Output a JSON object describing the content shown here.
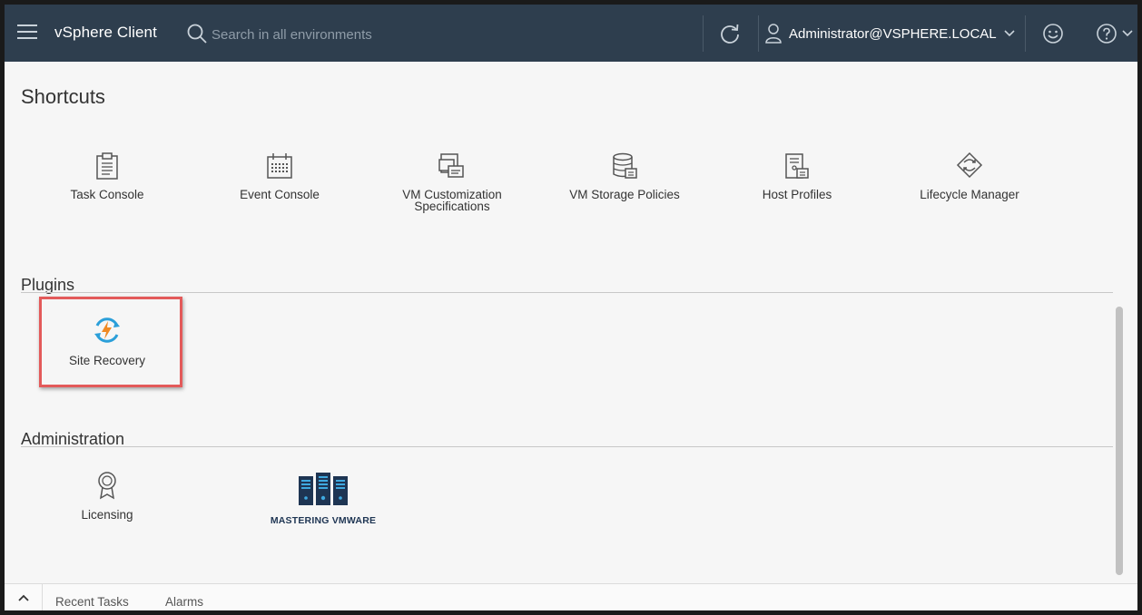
{
  "header": {
    "app_title": "vSphere Client",
    "search_placeholder": "Search in all environments",
    "user_name": "Administrator@VSPHERE.LOCAL"
  },
  "content": {
    "page_title": "Shortcuts",
    "shortcuts": [
      {
        "label": "Task Console",
        "icon": "clipboard-icon"
      },
      {
        "label": "Event Console",
        "icon": "calendar-icon"
      },
      {
        "label": "VM Customization Specifications",
        "icon": "vm-customization-icon"
      },
      {
        "label": "VM Storage Policies",
        "icon": "storage-policy-icon"
      },
      {
        "label": "Host Profiles",
        "icon": "host-profile-icon"
      },
      {
        "label": "Lifecycle Manager",
        "icon": "lifecycle-icon"
      }
    ],
    "plugins": {
      "title": "Plugins",
      "items": [
        {
          "label": "Site Recovery",
          "icon": "site-recovery-icon"
        }
      ]
    },
    "administration": {
      "title": "Administration",
      "items": [
        {
          "label": "Licensing",
          "icon": "license-ribbon-icon"
        }
      ],
      "logo_text": "MASTERING VMWARE"
    }
  },
  "bottom_bar": {
    "tabs": [
      "Recent Tasks",
      "Alarms"
    ]
  },
  "colors": {
    "header_bg": "#2e3e4e",
    "highlight_border": "#e35a5a",
    "site_recovery_blue": "#2b9fd9",
    "site_recovery_orange": "#f08a24"
  }
}
